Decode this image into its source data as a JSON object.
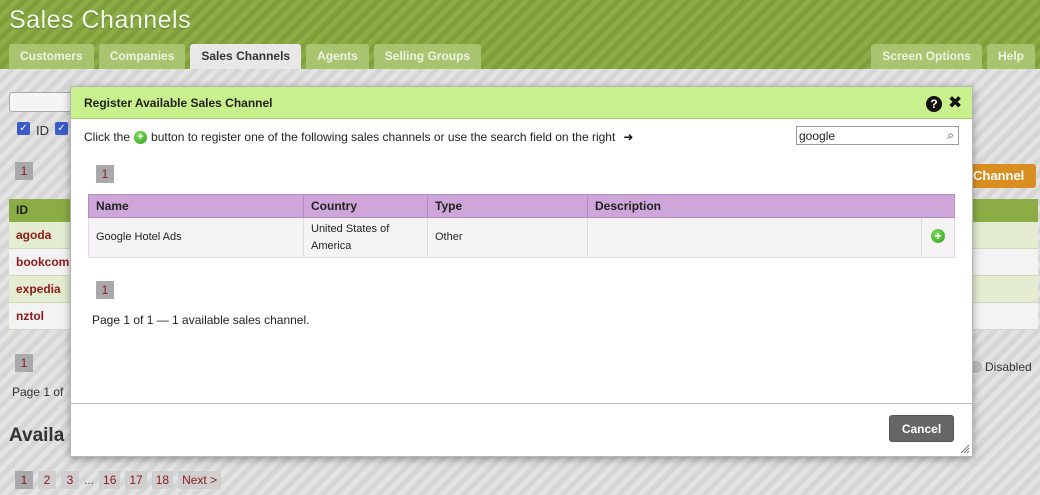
{
  "header": {
    "title": "Sales Channels",
    "tabs": [
      {
        "label": "Customers"
      },
      {
        "label": "Companies"
      },
      {
        "label": "Sales Channels"
      },
      {
        "label": "Agents"
      },
      {
        "label": "Selling Groups"
      }
    ],
    "screen_options": "Screen Options",
    "help": "Help"
  },
  "background": {
    "id_label": "ID",
    "top_page": "1",
    "add_button": "Channel",
    "table_header": "ID",
    "rows": [
      "agoda",
      "bookcom",
      "expedia",
      "nztol"
    ],
    "bottom_page": "1",
    "page_of": "Page 1 of",
    "disabled_label": "Disabled",
    "available_heading": "Availa",
    "pager": [
      "1",
      "2",
      "3",
      "...",
      "16",
      "17",
      "18",
      "Next >"
    ]
  },
  "modal": {
    "title": "Register Available Sales Channel",
    "instructions_before": "Click the",
    "instructions_after": "button to register one of the following sales channels or use the search field on the right",
    "search": {
      "value": "google"
    },
    "top_page": "1",
    "columns": [
      "Name",
      "Country",
      "Type",
      "Description"
    ],
    "rows": [
      {
        "name": "Google Hotel Ads",
        "country": "United States of America",
        "type": "Other",
        "description": ""
      }
    ],
    "bottom_page": "1",
    "page_info": "Page 1 of 1 — 1 available sales channel.",
    "cancel_label": "Cancel"
  },
  "icons": {
    "add": "add-circle-icon",
    "help": "help-icon",
    "close": "close-icon",
    "search": "search-icon",
    "arrow": "arrow-right-icon"
  },
  "colors": {
    "header_green": "#8cad46",
    "modal_header": "#c8f08c",
    "table_header_purple": "#cfa6d9",
    "link_red": "#8b1a1a",
    "orange_button": "#d98f1f"
  }
}
